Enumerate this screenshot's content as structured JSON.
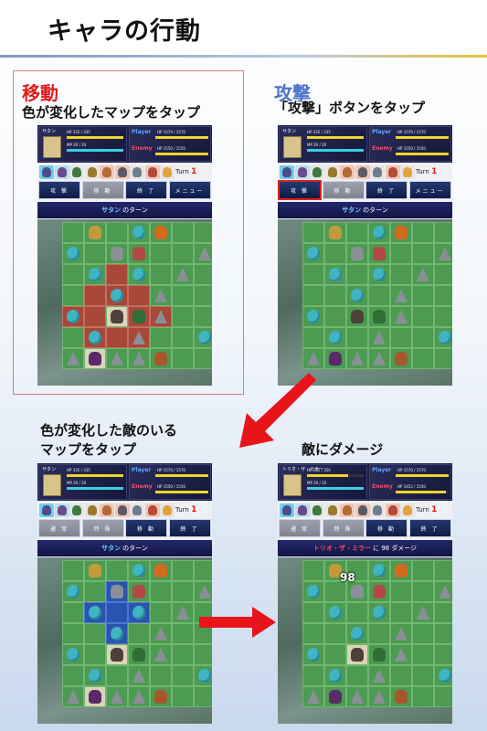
{
  "page": {
    "title": "キャラの行動"
  },
  "sections": {
    "move": {
      "heading": "移動",
      "caption": "色が変化したマップをタップ"
    },
    "attack": {
      "heading": "攻撃",
      "caption": "「攻撃」ボタンをタップ"
    },
    "target": {
      "caption_line1": "色が変化した敵のいる",
      "caption_line2": "マップをタップ"
    },
    "damage": {
      "caption": "敵にダメージ"
    }
  },
  "status_common": {
    "player_label": "Player",
    "enemy_label": "Enemy",
    "player_hp": "HP 1570 / 1570",
    "enemy_hp": "HP 1550 / 1550",
    "enemy_hp_after": "HP 1452 / 1550",
    "turn_label": "Turn",
    "turn_number": "1"
  },
  "panels": {
    "p1": {
      "unit_name": "サタン",
      "unit_hp": "HP 335 / 335",
      "unit_mp": "MP 20 / 20",
      "buttons": [
        "攻 撃",
        "移 動",
        "終 了",
        "メニュー"
      ],
      "banner_name": "サタン",
      "banner_suffix": "のターン"
    },
    "p2": {
      "unit_name": "サタン",
      "unit_hp": "HP 335 / 335",
      "unit_mp": "MP 20 / 20",
      "buttons": [
        "攻 撃",
        "移 動",
        "終 了",
        "メニュー"
      ],
      "banner_name": "サタン",
      "banner_suffix": "のターン"
    },
    "p3": {
      "unit_name": "サタン",
      "unit_hp": "HP 335 / 335",
      "unit_mp": "MP 20 / 20",
      "buttons": [
        "通 常",
        "特 殊",
        "移 動",
        "終 了"
      ],
      "banner_name": "サタン",
      "banner_suffix": "のターン"
    },
    "p4": {
      "unit_name": "トリオ・ザ・ミラー",
      "unit_hp": "HP 252 / 350",
      "unit_mp": "MP 20 / 20",
      "buttons": [
        "通 常",
        "特 殊",
        "移 動",
        "終 了"
      ],
      "banner_name": "トリオ・ザ・ミラー",
      "banner_suffix": "に 98 ダメージ",
      "damage_popup": "98"
    }
  },
  "colors": {
    "move_heading": "#e01b1b",
    "attack_heading": "#4a74c8",
    "arrow": "#e8141a",
    "move_highlight": "#a8473a",
    "attack_highlight": "#2b54b0"
  },
  "icons": {
    "unit_portrait": "demon-portrait-icon",
    "objects": [
      "crystal-icon",
      "rock-icon",
      "unit-icon"
    ]
  }
}
